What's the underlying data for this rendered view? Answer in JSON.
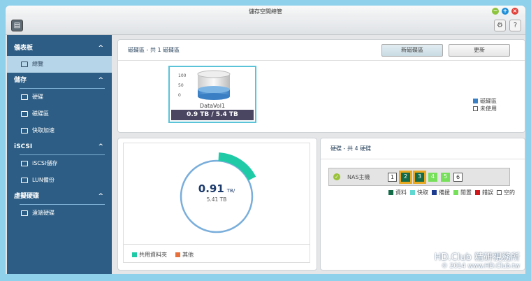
{
  "window": {
    "title": "儲存空間總管"
  },
  "sidebar": {
    "sections": [
      {
        "label": "儀表板",
        "items": [
          {
            "label": "總覽",
            "active": true
          }
        ]
      },
      {
        "label": "儲存",
        "items": [
          {
            "label": "硬碟"
          },
          {
            "label": "磁碟區"
          },
          {
            "label": "快取加速"
          }
        ]
      },
      {
        "label": "iSCSI",
        "items": [
          {
            "label": "iSCSI儲存"
          },
          {
            "label": "LUN備份"
          }
        ]
      },
      {
        "label": "虛擬硬碟",
        "items": [
          {
            "label": "遠端硬碟"
          }
        ]
      }
    ]
  },
  "volumes": {
    "header": "磁碟區 - 共 1 磁碟區",
    "new_button": "新磁碟區",
    "refresh_button": "更新",
    "card": {
      "name": "DataVol1",
      "usage": "0.9 TB / 5.4 TB",
      "scale": [
        "100",
        "50",
        "0"
      ],
      "fill_percent": 17
    },
    "legend": [
      {
        "label": "磁碟區",
        "color": "#3a7fc4"
      },
      {
        "label": "未使用",
        "color": "#ffffff"
      }
    ]
  },
  "usage": {
    "used": "0.91",
    "used_unit": "TB/",
    "total": "5.41 TB",
    "fraction": 0.168,
    "legend": [
      {
        "label": "共用資料夾",
        "color": "#1fcba6"
      },
      {
        "label": "其他",
        "color": "#e8703a"
      }
    ]
  },
  "disks": {
    "header": "硬碟 - 共 4 硬碟",
    "host": "NAS主機",
    "slots": [
      {
        "n": "1",
        "state": "empty"
      },
      {
        "n": "2",
        "state": "data"
      },
      {
        "n": "3",
        "state": "data"
      },
      {
        "n": "4",
        "state": "idle"
      },
      {
        "n": "5",
        "state": "idle"
      },
      {
        "n": "6",
        "state": "empty"
      }
    ],
    "legend": [
      {
        "label": "資料",
        "color": "#136b47"
      },
      {
        "label": "快取",
        "color": "#5ed8d0"
      },
      {
        "label": "備援",
        "color": "#1d3b8f"
      },
      {
        "label": "閒置",
        "color": "#77e05a"
      },
      {
        "label": "錯誤",
        "color": "#d0181c"
      },
      {
        "label": "空的",
        "color": "#ffffff"
      }
    ]
  },
  "watermark": {
    "brand": "HD.Club 精研視務所",
    "line2": "© 2014 www.HD.Club.tw"
  }
}
